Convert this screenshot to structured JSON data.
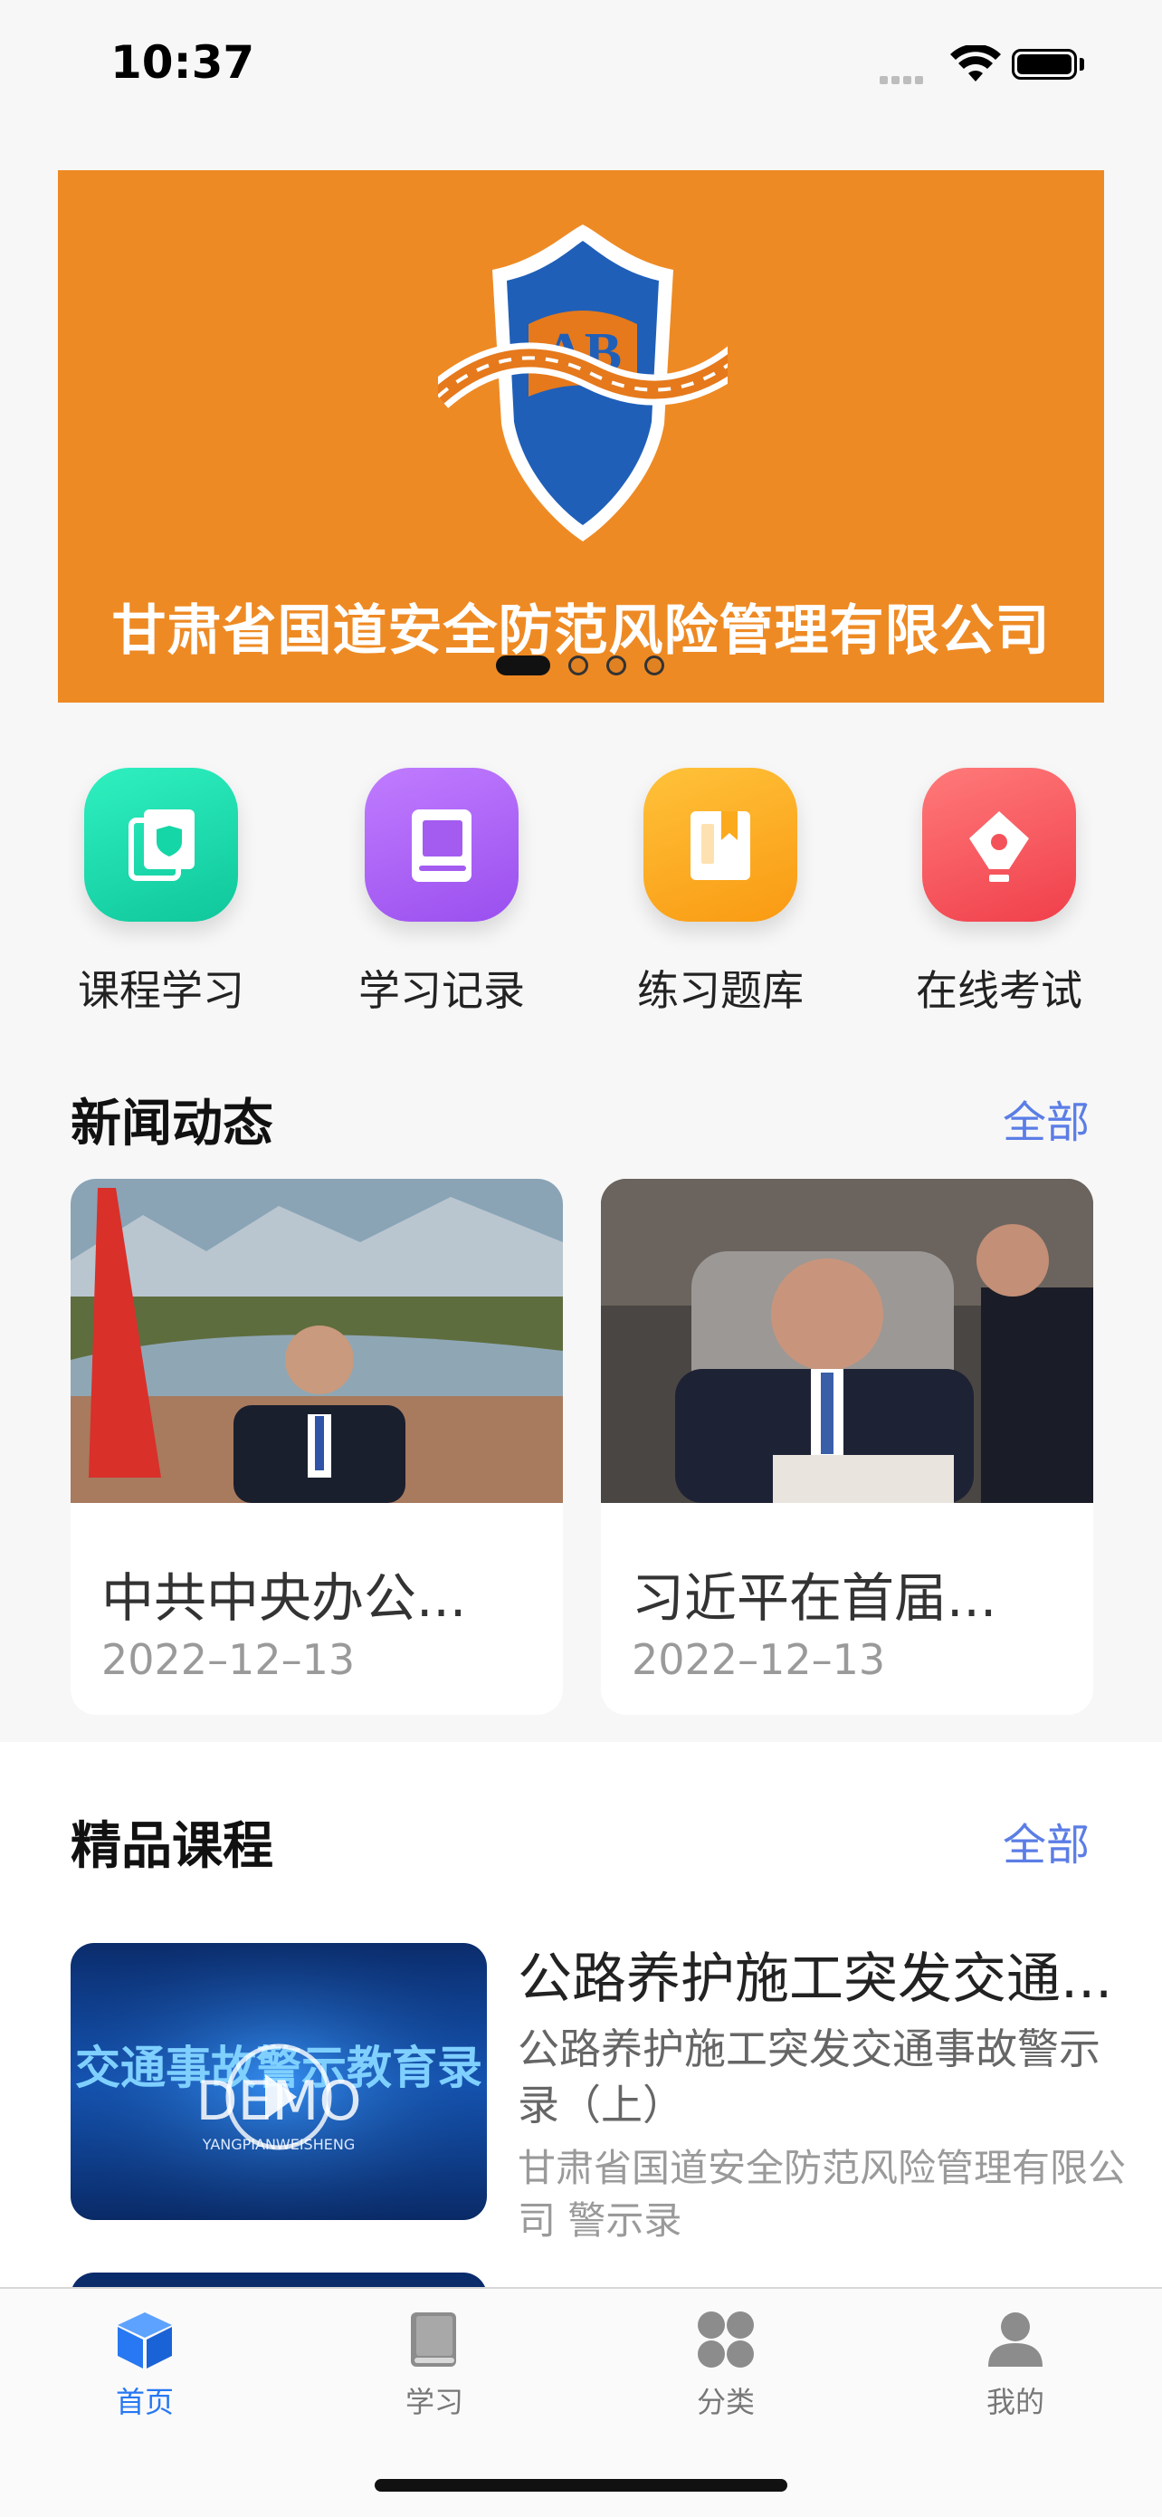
{
  "status_bar": {
    "time": "10:37"
  },
  "banner": {
    "title": "甘肃省国道安全防范风险管理有限公司",
    "logo_text": "AB",
    "background": "#ee8a24",
    "slides_total": 4,
    "active_slide": 1
  },
  "quick_actions": [
    {
      "label": "课程学习",
      "icon": "shield-doc-icon",
      "color": "#14d6a6"
    },
    {
      "label": "学习记录",
      "icon": "book-icon",
      "color": "#a45cf0"
    },
    {
      "label": "练习题库",
      "icon": "bookmark-book-icon",
      "color": "#fbaa1e"
    },
    {
      "label": "在线考试",
      "icon": "pen-nib-icon",
      "color": "#f4525a"
    }
  ],
  "news": {
    "title": "新闻动态",
    "more": "全部",
    "items": [
      {
        "title": "中共中央办公...",
        "date": "2022–12–13"
      },
      {
        "title": "习近平在首届...",
        "date": "2022–12–13"
      }
    ]
  },
  "courses": {
    "title": "精品课程",
    "more": "全部",
    "items": [
      {
        "title": "公路养护施工突发交通...",
        "subtitle": "公路养护施工突发交通事故警示录（上）",
        "org": "甘肃省国道安全防范风险管理有限公司 警示录",
        "thumb_text": "交通事故警示教育录",
        "thumb_watermark": "DEMO",
        "thumb_caption": "YANGPIANWEISHENG"
      }
    ]
  },
  "tabbar": {
    "items": [
      {
        "label": "首页",
        "icon": "cube-icon",
        "active": true
      },
      {
        "label": "学习",
        "icon": "book-icon",
        "active": false
      },
      {
        "label": "分类",
        "icon": "grid-icon",
        "active": false
      },
      {
        "label": "我的",
        "icon": "person-icon",
        "active": false
      }
    ],
    "active_color": "#2778f2"
  }
}
